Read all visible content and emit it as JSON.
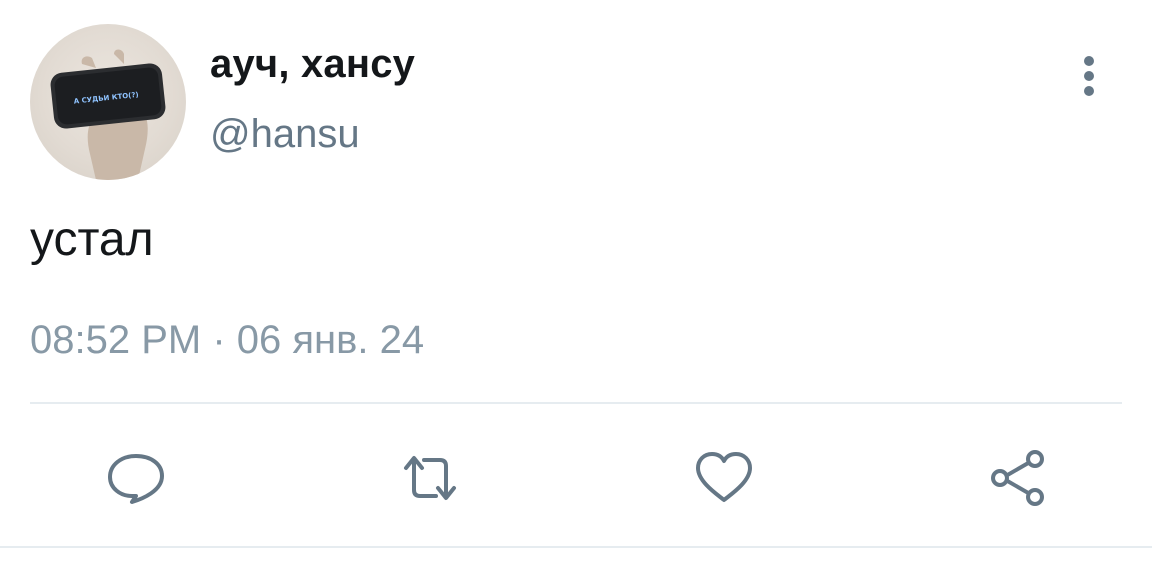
{
  "author": {
    "display_name": "ауч, хансу",
    "handle": "@hansu",
    "avatar_phone_text": "А СУДЬИ КТО(?)"
  },
  "tweet": {
    "text": "устал",
    "timestamp": "08:52 PM · 06 янв. 24"
  },
  "actions": [
    "reply-icon",
    "retweet-icon",
    "like-icon",
    "share-icon"
  ],
  "colors": {
    "text": "#14171a",
    "secondary": "#657786",
    "timestamp": "#8899a6",
    "divider": "#e6ecf0"
  }
}
